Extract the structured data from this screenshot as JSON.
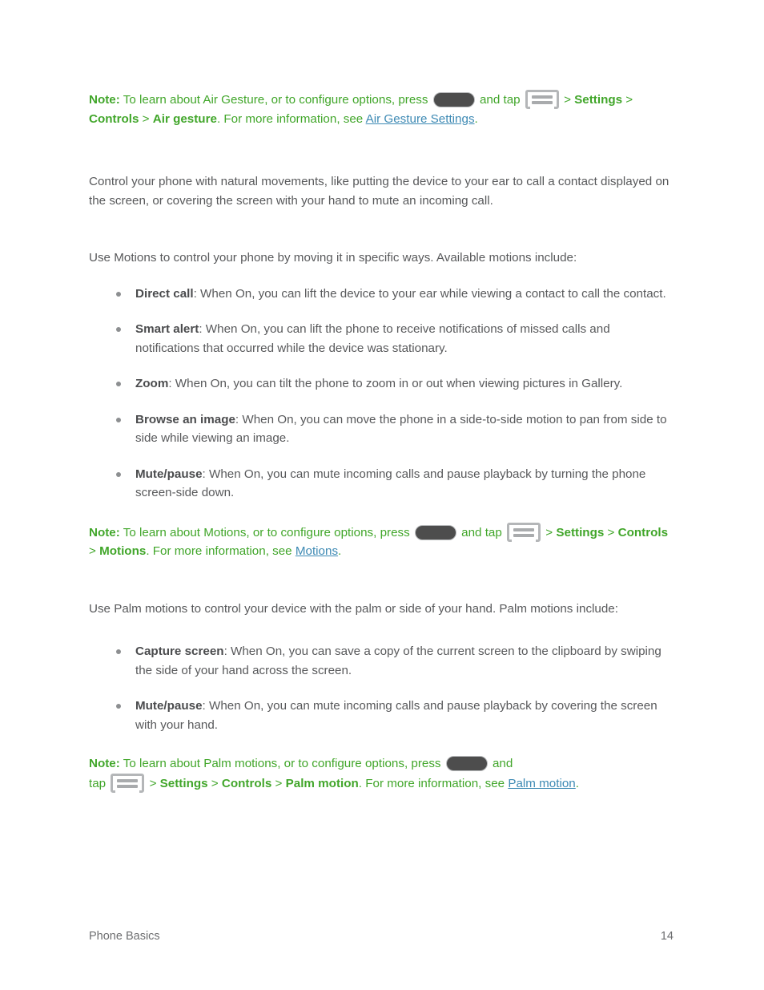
{
  "document": {
    "footer": {
      "section_label": "Phone Basics",
      "page_number": "14"
    }
  },
  "colors": {
    "note_green": "#41a62a",
    "link_blue": "#3e8ab4",
    "body_gray": "#58595b",
    "bullet_gray": "#8d8f91",
    "home_button_fill": "#4d4d4d",
    "menu_icon_gray": "#b4b6b8"
  },
  "icons": {
    "home_button": "home-button-icon",
    "menu_button": "menu-button-icon"
  },
  "notes": {
    "air_gesture": {
      "label": "Note:",
      "t1": " To learn about Air Gesture, or to configure options, press ",
      "t2": " and tap ",
      "t3": " > ",
      "b_settings": "Settings",
      "sep1": " > ",
      "b_controls": "Controls",
      "sep2": " > ",
      "b_target": "Air gesture",
      "t4": ". For more information, see ",
      "link": "Air Gesture Settings",
      "t5": "."
    },
    "motions": {
      "label": "Note:",
      "t1": " To learn about Motions, or to configure options, press ",
      "t2": " and tap ",
      "t3": " > ",
      "b_settings": "Settings",
      "sep1": " > ",
      "b_controls": "Controls",
      "sep2": " > ",
      "b_target": "Motions",
      "t4": ". For more information, see ",
      "link": "Motions",
      "t5": "."
    },
    "palm_motions": {
      "label": "Note:",
      "t1": " To learn about Palm motions, or to configure options, press ",
      "t2": " and",
      "t3": "tap ",
      "t4": " > ",
      "b_settings": "Settings",
      "sep1": " > ",
      "b_controls": "Controls",
      "sep2": " > ",
      "b_target": "Palm motion",
      "t5": ". For more information, see ",
      "link": "Palm motion",
      "t6": "."
    }
  },
  "paragraphs": {
    "intro": "Control your phone with natural movements, like putting the device to your ear to call a contact displayed on the screen, or covering the screen with your hand to mute an incoming call.",
    "motions_intro": "Use Motions to control your phone by moving it in specific ways. Available motions include:",
    "palm_intro": "Use Palm motions to control your device with the palm or side of your hand. Palm motions include:"
  },
  "motions_list": [
    {
      "term": "Direct call",
      "desc": ": When On, you can lift the device to your ear while viewing a contact to call the contact."
    },
    {
      "term": "Smart alert",
      "desc": ": When On, you can lift the phone to receive notifications of missed calls and notifications that occurred while the device was stationary."
    },
    {
      "term": "Zoom",
      "desc": ": When On, you can tilt the phone to zoom in or out when viewing pictures in Gallery."
    },
    {
      "term": "Browse an image",
      "desc": ": When On, you can move the phone in a side-to-side motion to pan from side to side while viewing an image."
    },
    {
      "term": "Mute/pause",
      "desc": ": When On, you can mute incoming calls and pause playback by turning the phone screen-side down."
    }
  ],
  "palm_list": [
    {
      "term": "Capture screen",
      "desc": ": When On, you can save a copy of the current screen to the clipboard by swiping the side of your hand across the screen."
    },
    {
      "term": "Mute/pause",
      "desc": ": When On, you can mute incoming calls and pause playback by covering the screen with your hand."
    }
  ]
}
